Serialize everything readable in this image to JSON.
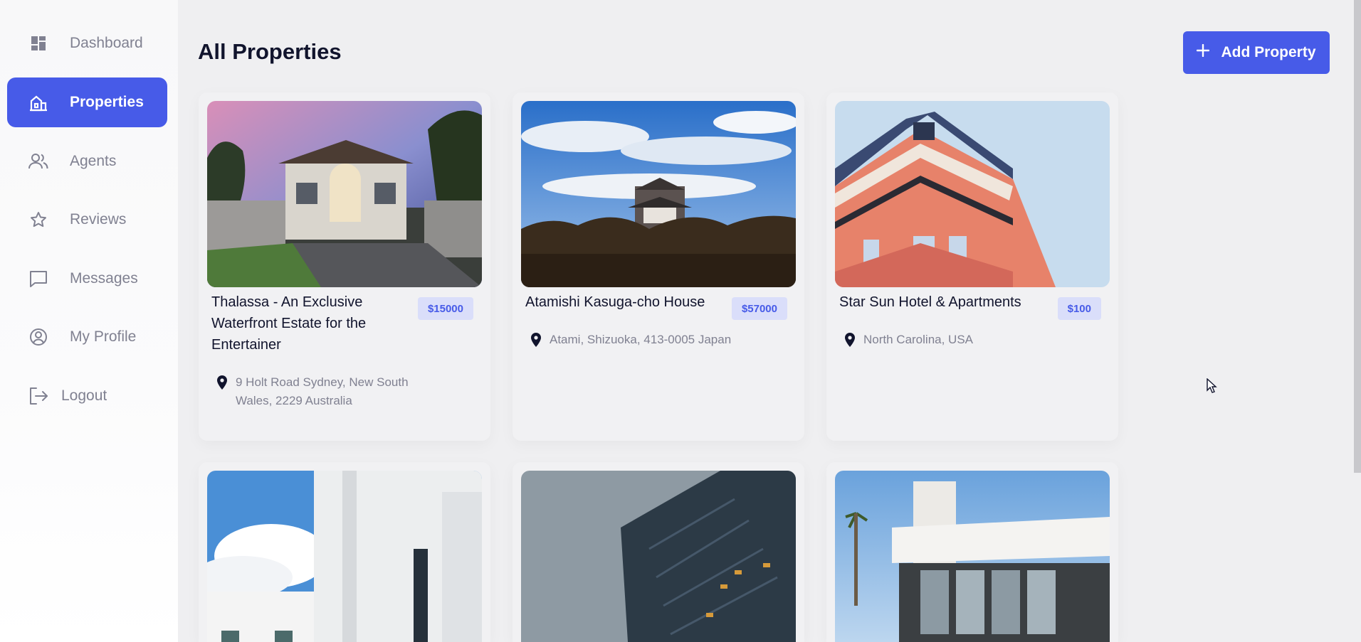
{
  "sidebar": {
    "items": [
      {
        "label": "Dashboard",
        "icon": "dashboard-icon"
      },
      {
        "label": "Properties",
        "icon": "properties-icon",
        "active": true
      },
      {
        "label": "Agents",
        "icon": "agents-icon"
      },
      {
        "label": "Reviews",
        "icon": "star-icon"
      },
      {
        "label": "Messages",
        "icon": "message-icon"
      },
      {
        "label": "My Profile",
        "icon": "profile-icon"
      },
      {
        "label": "Logout",
        "icon": "logout-icon"
      }
    ]
  },
  "header": {
    "title": "All Properties",
    "add_button_label": "Add Property"
  },
  "properties": [
    {
      "name": "Thalassa - An Exclusive Waterfront Estate for the Entertainer",
      "price": "$15000",
      "location": "9 Holt Road Sydney, New South Wales, 2229 Australia"
    },
    {
      "name": "Atamishi Kasuga-cho House",
      "price": "$57000",
      "location": "Atami, Shizuoka, 413-0005 Japan"
    },
    {
      "name": "Star Sun Hotel & Apartments",
      "price": "$100",
      "location": "North Carolina, USA"
    }
  ],
  "colors": {
    "accent": "#475be8",
    "price_bg": "#dadefa",
    "muted_text": "#808191",
    "title_text": "#11142d"
  }
}
